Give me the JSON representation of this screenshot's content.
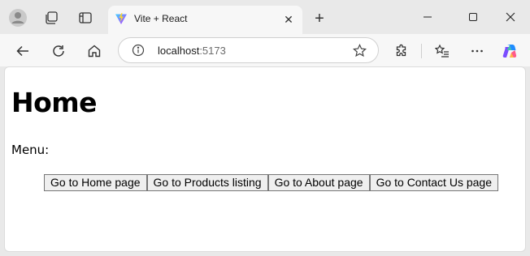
{
  "browser": {
    "tab": {
      "title": "Vite + React"
    },
    "address": {
      "host": "localhost",
      "port": ":5173"
    },
    "icons": {
      "profile": "profile-avatar-icon",
      "workspaces": "workspaces-icon",
      "tab_actions": "vertical-tabs-icon",
      "back": "back-arrow-icon",
      "reload": "reload-icon",
      "home": "home-icon",
      "site_info": "site-info-icon",
      "favorite": "star-icon",
      "extensions": "extensions-icon",
      "favorites": "favorites-list-icon",
      "more": "more-icon",
      "copilot": "copilot-icon"
    }
  },
  "page": {
    "heading": "Home",
    "menu_label": "Menu:",
    "buttons": [
      {
        "label": "Go to Home page"
      },
      {
        "label": "Go to Products listing"
      },
      {
        "label": "Go to About page"
      },
      {
        "label": "Go to Contact Us page"
      }
    ]
  },
  "colors": {
    "frame": "#e9e9e9",
    "toolbar": "#f7f7f7",
    "page_bg": "#ffffff",
    "button_bg": "#efefef",
    "button_border": "#767676"
  }
}
